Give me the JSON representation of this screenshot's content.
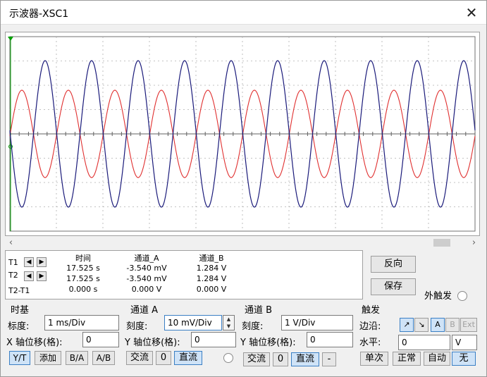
{
  "window": {
    "title": "示波器-XSC1",
    "close_glyph": "✕"
  },
  "screen": {
    "ch_a_color": "#e03030",
    "ch_b_color": "#1a1a7a",
    "grid_color": "#b0b0b0"
  },
  "scrollbar": {
    "left_arrow": "‹",
    "right_arrow": "›"
  },
  "readout": {
    "row_labels": [
      "T1",
      "T2",
      "T2-T1"
    ],
    "headers": [
      "时间",
      "通道_A",
      "通道_B"
    ],
    "rows": [
      [
        "17.525 s",
        "-3.540 mV",
        "1.284 V"
      ],
      [
        "17.525 s",
        "-3.540 mV",
        "1.284 V"
      ],
      [
        "0.000 s",
        "0.000 V",
        "0.000 V"
      ]
    ]
  },
  "buttons": {
    "reverse": "反向",
    "save": "保存",
    "ext_trigger": "外触发"
  },
  "timebase": {
    "title": "时基",
    "scale_label": "标度:",
    "scale_value": "1 ms/Div",
    "xpos_label": "X 轴位移(格):",
    "xpos_value": "0",
    "modes": [
      "Y/T",
      "添加",
      "B/A",
      "A/B"
    ]
  },
  "channel_a": {
    "title": "通道 A",
    "scale_label": "刻度:",
    "scale_value": "10 mV/Div",
    "ypos_label": "Y 轴位移(格):",
    "ypos_value": "0",
    "coupling": [
      "交流",
      "0",
      "直流"
    ]
  },
  "channel_b": {
    "title": "通道 B",
    "scale_label": "刻度:",
    "scale_value": "1  V/Div",
    "ypos_label": "Y 轴位移(格):",
    "ypos_value": "0",
    "coupling": [
      "交流",
      "0",
      "直流",
      "-"
    ]
  },
  "trigger": {
    "title": "触发",
    "edge_label": "边沿:",
    "edge_buttons": [
      "↗",
      "↘",
      "A",
      "B",
      "Ext"
    ],
    "level_label": "水平:",
    "level_value": "0",
    "level_unit": "V",
    "modes": [
      "单次",
      "正常",
      "自动",
      "无"
    ]
  }
}
